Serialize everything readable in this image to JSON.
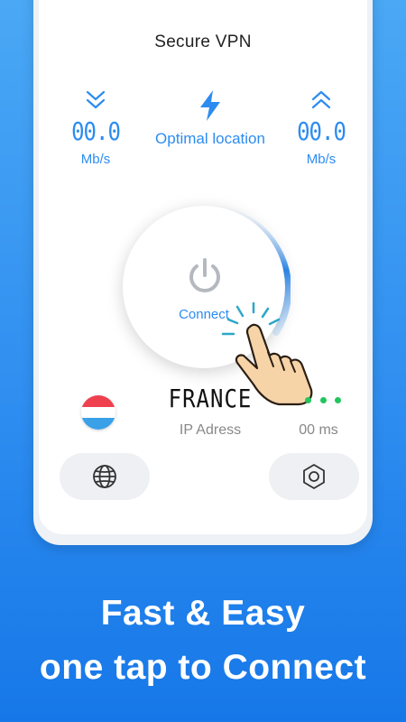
{
  "app": {
    "title": "Secure VPN"
  },
  "stats": {
    "download": {
      "value": "00.0",
      "unit": "Mb/s",
      "icon": "chevrons-down-icon"
    },
    "upload": {
      "value": "00.0",
      "unit": "Mb/s",
      "icon": "chevrons-up-icon"
    },
    "location": {
      "label": "Optimal location",
      "icon": "lightning-bolt-icon"
    }
  },
  "power": {
    "label": "Connect",
    "icon": "power-icon"
  },
  "server": {
    "country": "FRANCE",
    "ip_label": "IP Adress",
    "ping": "00 ms",
    "flag": "luxembourg-flag-icon"
  },
  "nav": {
    "left_icon": "globe-icon",
    "right_icon": "settings-hexagon-icon"
  },
  "promo": {
    "line1": "Fast & Easy",
    "line2": "one tap to Connect"
  },
  "colors": {
    "accent": "#2d8cf0",
    "background": "#2f8ef0",
    "online": "#22c55e"
  }
}
